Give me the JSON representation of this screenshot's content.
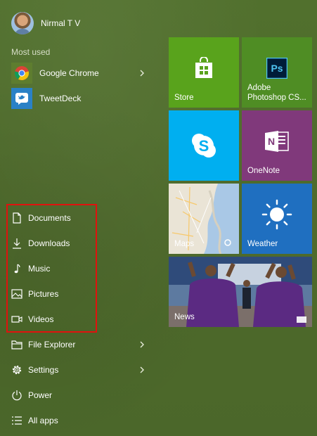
{
  "user": {
    "name": "Nirmal T V"
  },
  "most_used": {
    "label": "Most used",
    "apps": [
      {
        "label": "Google Chrome",
        "icon": "chrome-icon",
        "has_submenu": true
      },
      {
        "label": "TweetDeck",
        "icon": "tweetdeck-icon",
        "has_submenu": false
      }
    ]
  },
  "places": [
    {
      "label": "Documents",
      "icon": "document-icon"
    },
    {
      "label": "Downloads",
      "icon": "download-icon"
    },
    {
      "label": "Music",
      "icon": "music-note-icon"
    },
    {
      "label": "Pictures",
      "icon": "picture-icon"
    },
    {
      "label": "Videos",
      "icon": "video-camera-icon"
    }
  ],
  "system": [
    {
      "label": "File Explorer",
      "icon": "folder-icon",
      "has_submenu": true
    },
    {
      "label": "Settings",
      "icon": "gear-icon",
      "has_submenu": true
    },
    {
      "label": "Power",
      "icon": "power-icon"
    },
    {
      "label": "All apps",
      "icon": "list-icon"
    }
  ],
  "tiles": [
    {
      "label": "Store",
      "icon": "store-bag-icon",
      "color": "#59a31c"
    },
    {
      "label": "Adobe Photoshop CS...",
      "line1": "Adobe",
      "line2": "Photoshop CS...",
      "icon": "photoshop-icon",
      "color": "#4f8d24"
    },
    {
      "label": "",
      "icon": "skype-icon",
      "color": "#00aff0"
    },
    {
      "label": "OneNote",
      "icon": "onenote-icon",
      "color": "#80397b"
    },
    {
      "label": "Maps",
      "icon": "map-icon",
      "color": "#b9cfe6"
    },
    {
      "label": "Weather",
      "icon": "sun-icon",
      "color": "#1f6fc0"
    },
    {
      "label": "News",
      "icon": "news-icon",
      "color": "#3b4d63"
    }
  ],
  "colors": {
    "background": "#4f6b2c",
    "highlight_border": "#e0120e"
  }
}
